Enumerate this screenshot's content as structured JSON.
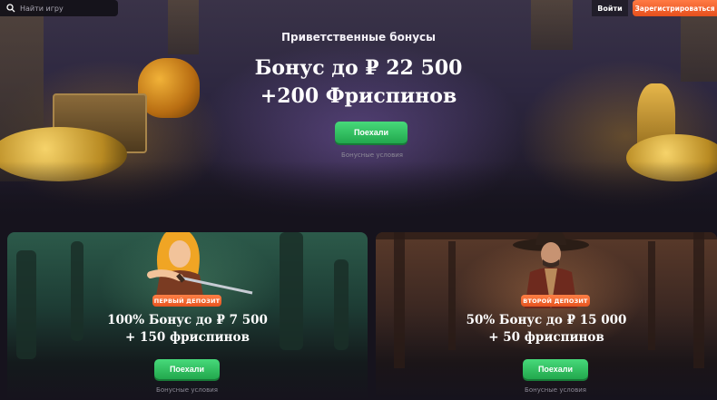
{
  "header": {
    "search_placeholder": "Найти игру",
    "login_label": "Войти",
    "register_label": "Зарегистрироваться"
  },
  "hero": {
    "subtitle": "Приветственные бонусы",
    "title_line1": "Бонус до ₽ 22 500",
    "title_line2": "+200 Фриспинов",
    "button_label": "Поехали",
    "terms_label": "Бонусные условия"
  },
  "offers": [
    {
      "badge": "ПЕРВЫЙ ДЕПОЗИТ",
      "title_line1": "100% Бонус до ₽ 7 500",
      "title_line2": "+ 150 фриспинов",
      "button_label": "Поехали",
      "terms_label": "Бонусные условия"
    },
    {
      "badge": "ВТОРОЙ ДЕПОЗИТ",
      "title_line1": "50% Бонус до ₽ 15 000",
      "title_line2": "+ 50 фриспинов",
      "button_label": "Поехали",
      "terms_label": "Бонусные условия"
    }
  ],
  "colors": {
    "accent_green": "#2fbf5e",
    "accent_orange": "#ee5f28",
    "background": "#16131d"
  },
  "icons": {
    "search": "search-icon"
  }
}
